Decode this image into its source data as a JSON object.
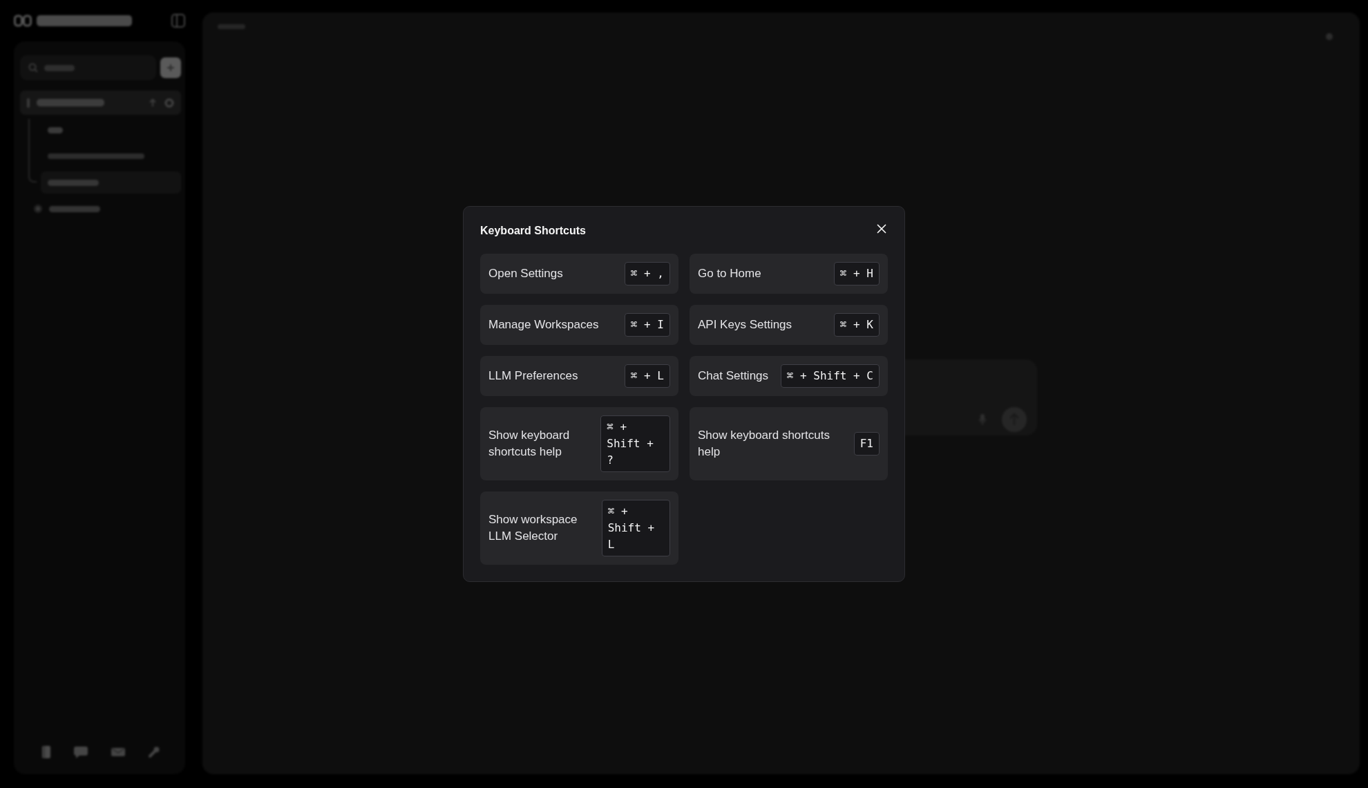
{
  "modal": {
    "title": "Keyboard Shortcuts",
    "shortcuts": [
      {
        "label": "Open Settings",
        "keys": "⌘ + ,"
      },
      {
        "label": "Go to Home",
        "keys": "⌘ + H"
      },
      {
        "label": "Manage Workspaces",
        "keys": "⌘ + I"
      },
      {
        "label": "API Keys Settings",
        "keys": "⌘ + K"
      },
      {
        "label": "LLM Preferences",
        "keys": "⌘ + L"
      },
      {
        "label": "Chat Settings",
        "keys": "⌘ + Shift + C"
      },
      {
        "label": "Show keyboard shortcuts help",
        "keys": "⌘ + Shift + ?"
      },
      {
        "label": "Show keyboard shortcuts help",
        "keys": "F1"
      },
      {
        "label": "Show workspace LLM Selector",
        "keys": "⌘ + Shift + L"
      }
    ]
  }
}
